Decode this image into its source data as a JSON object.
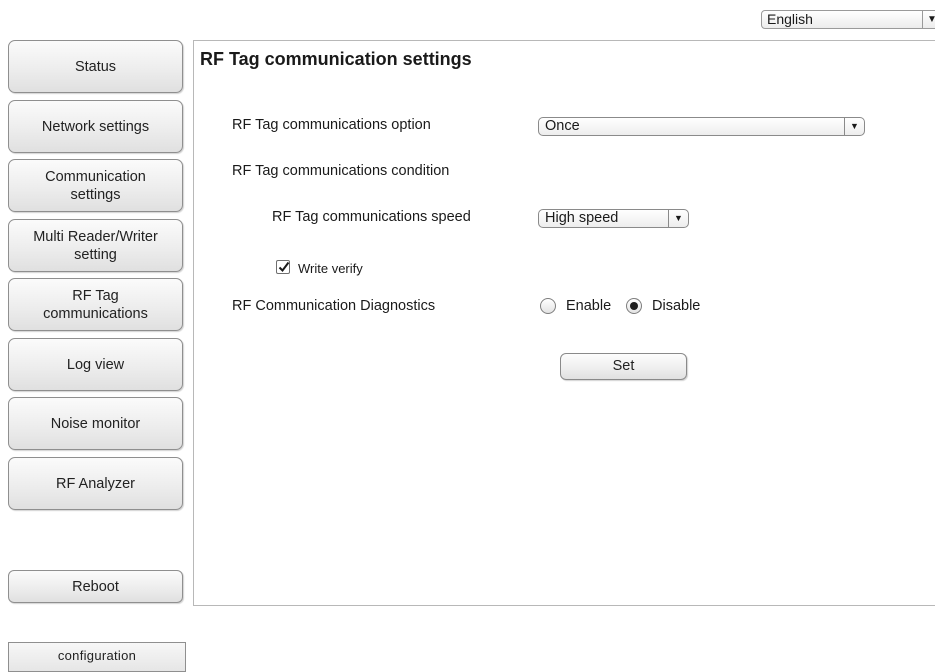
{
  "language": {
    "selected": "English"
  },
  "sidebar": {
    "items": [
      {
        "label": "Status"
      },
      {
        "label": "Network settings"
      },
      {
        "label": "Communication settings"
      },
      {
        "label": "Multi Reader/Writer setting"
      },
      {
        "label": "RF Tag communications"
      },
      {
        "label": "Log view"
      },
      {
        "label": "Noise monitor"
      },
      {
        "label": "RF Analyzer"
      }
    ],
    "reboot_label": "Reboot",
    "configuration_label": "configuration"
  },
  "main": {
    "title": "RF Tag communication settings",
    "option_label": "RF Tag communications option",
    "option_value": "Once",
    "condition_label": "RF Tag communications condition",
    "speed_label": "RF Tag communications speed",
    "speed_value": "High speed",
    "write_verify_label": "Write verify",
    "write_verify_checked": true,
    "diagnostics_label": "RF Communication Diagnostics",
    "diagnostics_options": [
      "Enable",
      "Disable"
    ],
    "diagnostics_selected": "Disable",
    "set_label": "Set"
  },
  "icons": {
    "dropdown": "chevron-down-icon",
    "check": "check-icon"
  }
}
